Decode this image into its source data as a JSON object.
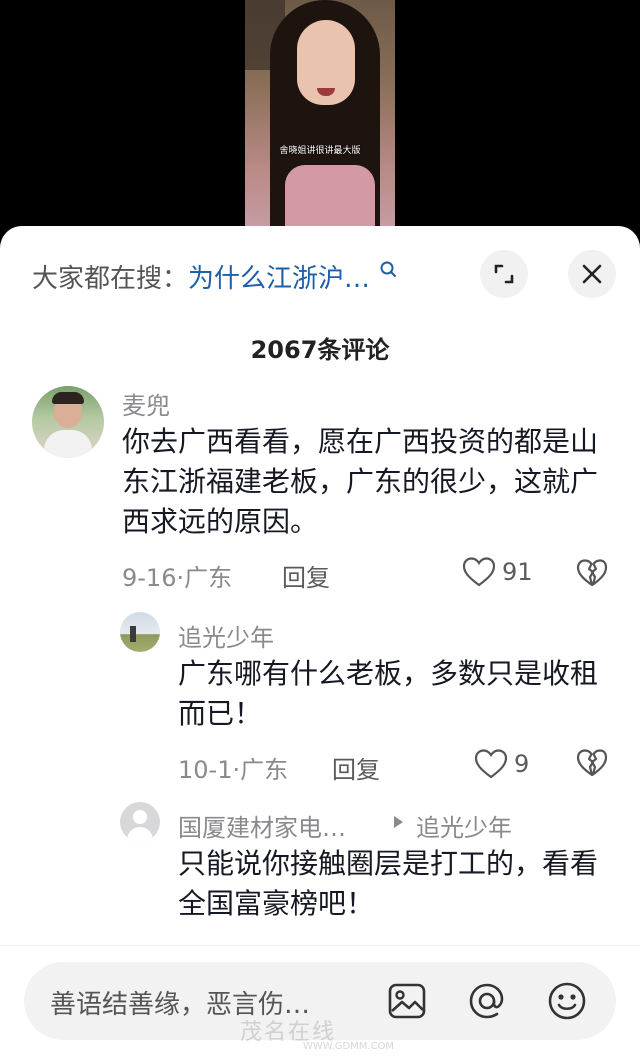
{
  "video": {
    "caption": "舍晓姐讲很讲最大版"
  },
  "search": {
    "prefix": "大家都在搜：",
    "query": "为什么江浙沪…"
  },
  "comments_count": "2067条评论",
  "comments": [
    {
      "author": "麦兜",
      "text": "你去广西看看，愿在广西投资的都是山东江浙福建老板，广东的很少，这就广西求远的原因。",
      "date": "9-16·广东",
      "reply_label": "回复",
      "likes": "91"
    },
    {
      "author": "追光少年",
      "text": "广东哪有什么老板，多数只是收租而已！",
      "date": "10-1·广东",
      "reply_label": "回复",
      "likes": "9"
    },
    {
      "author": "国厦建材家电…",
      "reply_to": "追光少年",
      "text": "只能说你接触圈层是打工的，看看全国富豪榜吧！"
    }
  ],
  "input": {
    "placeholder": "善语结善缘，恶言伤…"
  },
  "watermark": {
    "main": "茂名在线",
    "sub": "WWW.GDMM.COM"
  },
  "icons": [
    "search-icon",
    "expand-icon",
    "close-icon",
    "heart-icon",
    "dislike-icon",
    "image-icon",
    "mention-icon",
    "emoji-icon"
  ]
}
